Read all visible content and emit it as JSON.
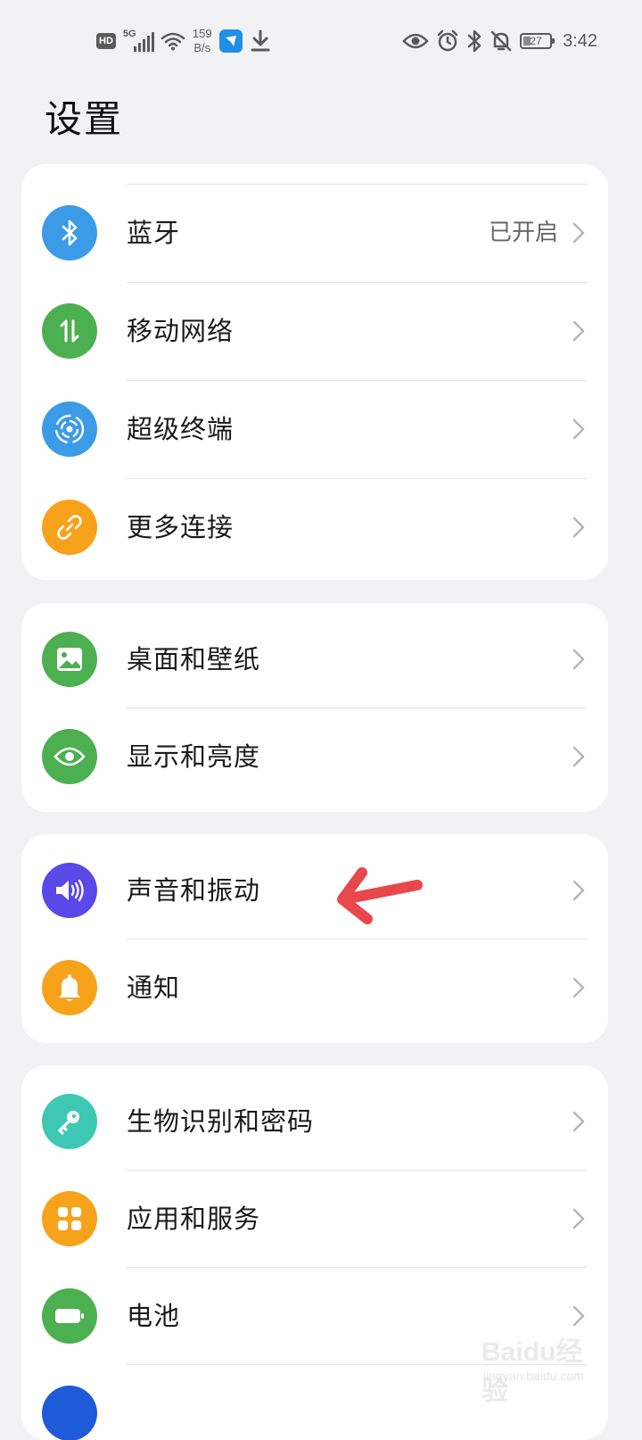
{
  "status_bar": {
    "hd": "HD",
    "network_gen": "5G",
    "speed_value": "159",
    "speed_unit": "B/s",
    "battery": "27",
    "time": "3:42"
  },
  "page": {
    "title": "设置"
  },
  "groups": [
    {
      "items": [
        {
          "label": "蓝牙",
          "value": "已开启",
          "icon": "bluetooth-icon",
          "color": "#3b9be6"
        },
        {
          "label": "移动网络",
          "icon": "mobile-data-icon",
          "color": "#4caf50"
        },
        {
          "label": "超级终端",
          "icon": "super-device-icon",
          "color": "#3b9be6"
        },
        {
          "label": "更多连接",
          "icon": "link-icon",
          "color": "#f7a21b"
        }
      ]
    },
    {
      "items": [
        {
          "label": "桌面和壁纸",
          "icon": "wallpaper-icon",
          "color": "#4caf50"
        },
        {
          "label": "显示和亮度",
          "icon": "eye-icon",
          "color": "#4caf50"
        }
      ]
    },
    {
      "items": [
        {
          "label": "声音和振动",
          "icon": "sound-icon",
          "color": "#5b48e8"
        },
        {
          "label": "通知",
          "icon": "bell-icon",
          "color": "#f7a21b"
        }
      ]
    },
    {
      "items": [
        {
          "label": "生物识别和密码",
          "icon": "key-icon",
          "color": "#3ec8b4"
        },
        {
          "label": "应用和服务",
          "icon": "apps-icon",
          "color": "#f7a21b"
        },
        {
          "label": "电池",
          "icon": "battery-icon",
          "color": "#4caf50"
        }
      ]
    }
  ],
  "annotation": {
    "color": "#e8474b",
    "target": "声音和振动"
  },
  "watermark": {
    "brand": "Baidu经验",
    "url": "jingyan.baidu.com"
  }
}
